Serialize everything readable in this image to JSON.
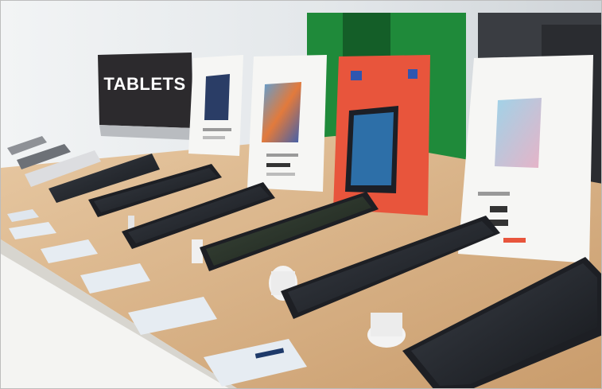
{
  "sign": {
    "text": "TABLETS"
  },
  "colors": {
    "wall": "#e9ecee",
    "counter_wood": "#d9b48a",
    "counter_edge": "#f4f4f2",
    "tablet_body": "#1d1f24",
    "tablet_screen": "#2b2f36",
    "sign_board": "#2c2a2d",
    "card_white": "#f6f6f4",
    "card_red": "#e8553c",
    "green_bg": "#1f8a3a"
  }
}
